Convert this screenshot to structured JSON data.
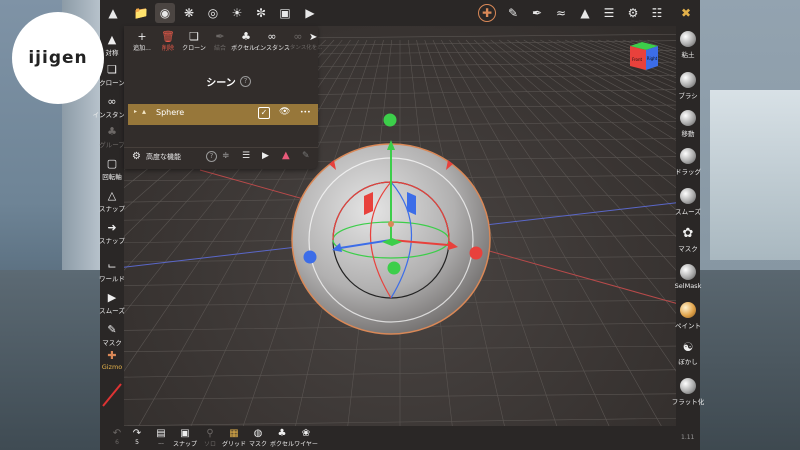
{
  "logo": {
    "text": "ijigen"
  },
  "top_toolbar": {
    "icons": [
      "cube-logo-icon",
      "folder-icon",
      "material-icon",
      "cluster-icon",
      "globe-icon",
      "sun-icon",
      "film-reel-icon",
      "image-icon",
      "video-icon"
    ],
    "right_icons": [
      "gizmo-icon",
      "pen-icon",
      "eyedropper-icon",
      "smooth-icon",
      "triangle-icon",
      "layers-icon",
      "gear-icon",
      "sliders-icon",
      "tools-icon"
    ]
  },
  "left_toolbar": {
    "items": [
      {
        "icon": "triangle-icon",
        "label": "対称"
      },
      {
        "icon": "instance-icon",
        "label": "クローン"
      },
      {
        "icon": "link-icon",
        "label": "インスタンス"
      },
      {
        "icon": "group-icon",
        "label": "グループ"
      },
      {
        "icon": "lock-icon",
        "label": "回転軸"
      },
      {
        "icon": "triangle-outline-icon",
        "label": "スナップ"
      },
      {
        "icon": "arrow-right-icon",
        "label": "スナップ"
      },
      {
        "icon": "axis-icon",
        "label": "ワールド"
      },
      {
        "icon": "play-icon",
        "label": "スムーズ"
      },
      {
        "icon": "edit-square-icon",
        "label": "マスク"
      },
      {
        "icon": "gizmo-icon",
        "label": "Gizmo"
      }
    ]
  },
  "scene_panel": {
    "tools": [
      {
        "icon": "+",
        "label": "追加..."
      },
      {
        "icon": "trash-icon",
        "label": "削除"
      },
      {
        "icon": "clone-icon",
        "label": "クローン"
      },
      {
        "icon": "merge-icon",
        "label": "結合"
      },
      {
        "icon": "voxel-icon",
        "label": "ボクセル..."
      },
      {
        "icon": "link-icon",
        "label": "インスタンス"
      },
      {
        "icon": "unlink-icon",
        "label": "インスタンス化を..."
      }
    ],
    "title": "シーン",
    "help": "?",
    "object": {
      "name": "Sphere",
      "checked": true,
      "visible": true,
      "more": "•••"
    },
    "advanced_label": "高度な機能"
  },
  "right_toolbar": {
    "items": [
      {
        "icon": "clay-icon",
        "label": "粘土"
      },
      {
        "icon": "brush-icon",
        "label": "ブラシ"
      },
      {
        "icon": "move-icon",
        "label": "移動"
      },
      {
        "icon": "drag-icon",
        "label": "ドラッグ"
      },
      {
        "icon": "smooth-icon",
        "label": "スムーズ"
      },
      {
        "icon": "mask-icon",
        "label": "マスク"
      },
      {
        "icon": "selmask-icon",
        "label": "SelMask"
      },
      {
        "icon": "paint-icon",
        "label": "ペイント"
      },
      {
        "icon": "blur-icon",
        "label": "ぼかし"
      },
      {
        "icon": "flatten-icon",
        "label": "フラット化"
      }
    ]
  },
  "bottom_toolbar": {
    "items": [
      {
        "icon": "undo-icon",
        "label": "6"
      },
      {
        "icon": "redo-icon",
        "label": "5"
      },
      {
        "icon": "save-icon",
        "label": "..."
      },
      {
        "icon": "camera-icon",
        "label": "スナップ"
      },
      {
        "icon": "search-icon",
        "label": "ソロ"
      },
      {
        "icon": "grid-icon",
        "label": "グリッド"
      },
      {
        "icon": "mask-eye-icon",
        "label": "マスク"
      },
      {
        "icon": "voxel-icon",
        "label": "ボクセル"
      },
      {
        "icon": "wireframe-icon",
        "label": "ワイヤー"
      }
    ]
  },
  "nav_cube": {
    "front": "Front",
    "right": "Right"
  },
  "corner_text": "1.11",
  "colors": {
    "accent": "#97773a",
    "panel": "#322d2b",
    "toolbar": "#2a2726",
    "gizmo_red": "#e8413c",
    "gizmo_green": "#3cce4a",
    "gizmo_blue": "#3c6de8"
  }
}
